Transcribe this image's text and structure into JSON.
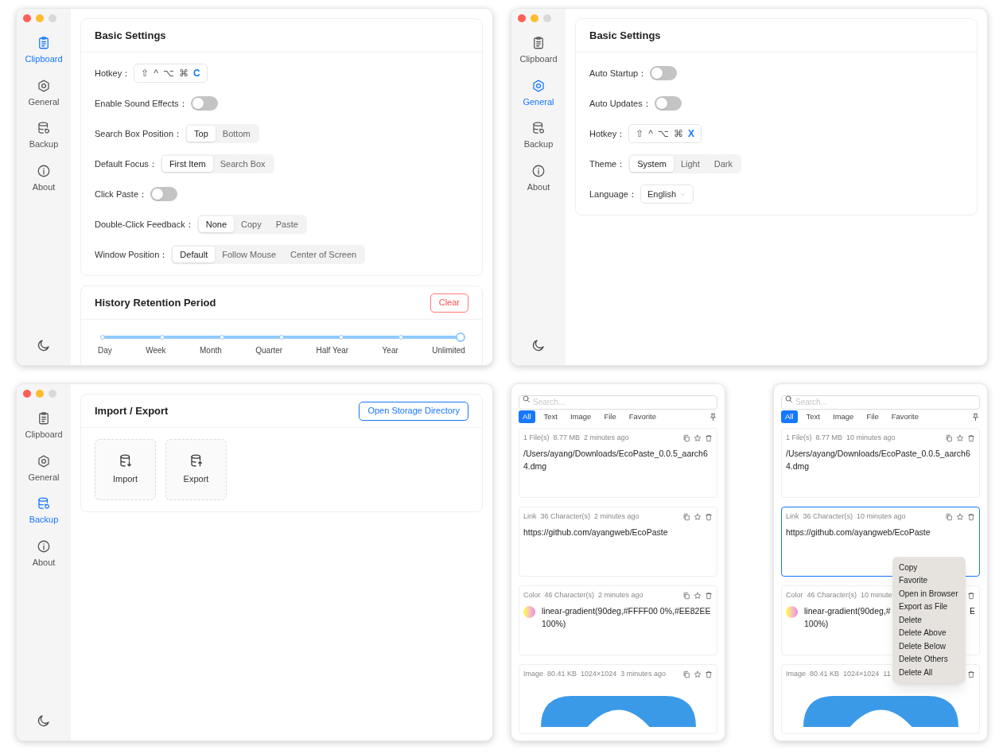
{
  "windows": [
    {
      "kind": "settings",
      "sidebar": [
        {
          "label": "Clipboard",
          "selected": true
        },
        {
          "label": "General",
          "selected": false
        },
        {
          "label": "Backup",
          "selected": false
        },
        {
          "label": "About",
          "selected": false
        }
      ],
      "cards": [
        {
          "title": "Basic Settings",
          "rows": [
            {
              "kind": "hotkey",
              "label": "Hotkey：",
              "keys": [
                "⇧",
                "^",
                "⌥",
                "⌘",
                "C"
              ]
            },
            {
              "kind": "toggle",
              "label": "Enable Sound Effects：",
              "on": false
            },
            {
              "kind": "segmented",
              "label": "Search Box Position：",
              "options": [
                {
                  "label": "Top",
                  "selected": true
                },
                {
                  "label": "Bottom",
                  "selected": false
                }
              ]
            },
            {
              "kind": "segmented",
              "label": "Default Focus：",
              "options": [
                {
                  "label": "First Item",
                  "selected": true
                },
                {
                  "label": "Search Box",
                  "selected": false
                }
              ]
            },
            {
              "kind": "toggle",
              "label": "Click Paste：",
              "on": false
            },
            {
              "kind": "segmented",
              "label": "Double-Click Feedback：",
              "options": [
                {
                  "label": "None",
                  "selected": true
                },
                {
                  "label": "Copy",
                  "selected": false
                },
                {
                  "label": "Paste",
                  "selected": false
                }
              ]
            },
            {
              "kind": "segmented",
              "label": "Window Position：",
              "options": [
                {
                  "label": "Default",
                  "selected": true
                },
                {
                  "label": "Follow Mouse",
                  "selected": false
                },
                {
                  "label": "Center of Screen",
                  "selected": false
                }
              ]
            }
          ]
        },
        {
          "title": "History Retention Period",
          "header_button": {
            "label": "Clear",
            "kind": "danger"
          },
          "slider": {
            "marks": [
              "Day",
              "Week",
              "Month",
              "Quarter",
              "Half Year",
              "Year",
              "Unlimited"
            ],
            "level": 1
          }
        }
      ]
    },
    {
      "kind": "settings",
      "sidebar": [
        {
          "label": "Clipboard",
          "selected": false
        },
        {
          "label": "General",
          "selected": true
        },
        {
          "label": "Backup",
          "selected": false
        },
        {
          "label": "About",
          "selected": false
        }
      ],
      "cards": [
        {
          "title": "Basic Settings",
          "rows": [
            {
              "kind": "toggle",
              "label": "Auto Startup：",
              "on": false
            },
            {
              "kind": "toggle",
              "label": "Auto Updates：",
              "on": false
            },
            {
              "kind": "hotkey",
              "label": "Hotkey：",
              "keys": [
                "⇧",
                "^",
                "⌥",
                "⌘",
                "X"
              ]
            },
            {
              "kind": "segmented",
              "label": "Theme：",
              "options": [
                {
                  "label": "System",
                  "selected": true
                },
                {
                  "label": "Light",
                  "selected": false
                },
                {
                  "label": "Dark",
                  "selected": false
                }
              ]
            },
            {
              "kind": "select",
              "label": "Language：",
              "value": "English"
            }
          ]
        }
      ]
    },
    {
      "kind": "settings",
      "sidebar": [
        {
          "label": "Clipboard",
          "selected": false
        },
        {
          "label": "General",
          "selected": false
        },
        {
          "label": "Backup",
          "selected": true
        },
        {
          "label": "About",
          "selected": false
        }
      ],
      "cards": [
        {
          "title": "Import / Export",
          "header_button": {
            "label": "Open Storage Directory",
            "kind": "primary"
          },
          "tiles": [
            "Import",
            "Export"
          ]
        }
      ]
    },
    {
      "kind": "clipboard",
      "search": {
        "placeholder": "Search..."
      },
      "tabs": [
        {
          "label": "All",
          "selected": true
        },
        {
          "label": "Text",
          "selected": false
        },
        {
          "label": "Image",
          "selected": false
        },
        {
          "label": "File",
          "selected": false
        },
        {
          "label": "Favorite",
          "selected": false
        }
      ],
      "items": [
        {
          "kind": "text",
          "selected": false,
          "meta": [
            "1 File(s)",
            "8.77 MB",
            "2 minutes ago"
          ],
          "lines": [
            [
              "/Users/ayang/Downloads/EcoPaste_0.0.5_aarch6"
            ],
            [
              "4.dmg"
            ]
          ]
        },
        {
          "kind": "text",
          "selected": false,
          "meta": [
            "Link",
            "36 Character(s)",
            "2 minutes ago"
          ],
          "lines": [
            [
              "https://github.com/ayangweb/EcoPaste"
            ]
          ]
        },
        {
          "kind": "color",
          "selected": false,
          "meta": [
            "Color",
            "46 Character(s)",
            "2 minutes ago"
          ],
          "lines": [
            [
              "linear-gradient(90deg,#FFFF00 0%,#EE82EE"
            ],
            [
              "100%)"
            ]
          ]
        },
        {
          "kind": "image",
          "selected": false,
          "meta": [
            "Image",
            "80.41 KB",
            "1024×1024",
            "3 minutes ago"
          ]
        }
      ]
    },
    {
      "kind": "clipboard",
      "search": {
        "placeholder": "Search..."
      },
      "tabs": [
        {
          "label": "All",
          "selected": true
        },
        {
          "label": "Text",
          "selected": false
        },
        {
          "label": "Image",
          "selected": false
        },
        {
          "label": "File",
          "selected": false
        },
        {
          "label": "Favorite",
          "selected": false
        }
      ],
      "items": [
        {
          "kind": "text",
          "selected": false,
          "meta": [
            "1 File(s)",
            "8.77 MB",
            "10 minutes ago"
          ],
          "lines": [
            [
              "/Users/ayang/Downloads/EcoPaste_0.0.5_aarch6"
            ],
            [
              "4.dmg"
            ]
          ]
        },
        {
          "kind": "text",
          "selected": true,
          "meta": [
            "Link",
            "36 Character(s)",
            "10 minutes ago"
          ],
          "lines": [
            [
              "https://github.com/ayangweb/EcoPaste"
            ]
          ]
        },
        {
          "kind": "color",
          "selected": false,
          "meta": [
            "Color",
            "46 Character(s)",
            "10 minute"
          ],
          "lines": [
            [
              "linear-gradient(90deg,#",
              "E"
            ],
            [
              "100%)"
            ]
          ]
        },
        {
          "kind": "image",
          "selected": false,
          "meta": [
            "Image",
            "80.41 KB",
            "1024×1024",
            "11"
          ]
        }
      ],
      "context_menu": [
        "Copy",
        "Favorite",
        "Open in Browser",
        "Export as File",
        "Delete",
        "Delete Above",
        "Delete Below",
        "Delete Others",
        "Delete All"
      ]
    }
  ]
}
